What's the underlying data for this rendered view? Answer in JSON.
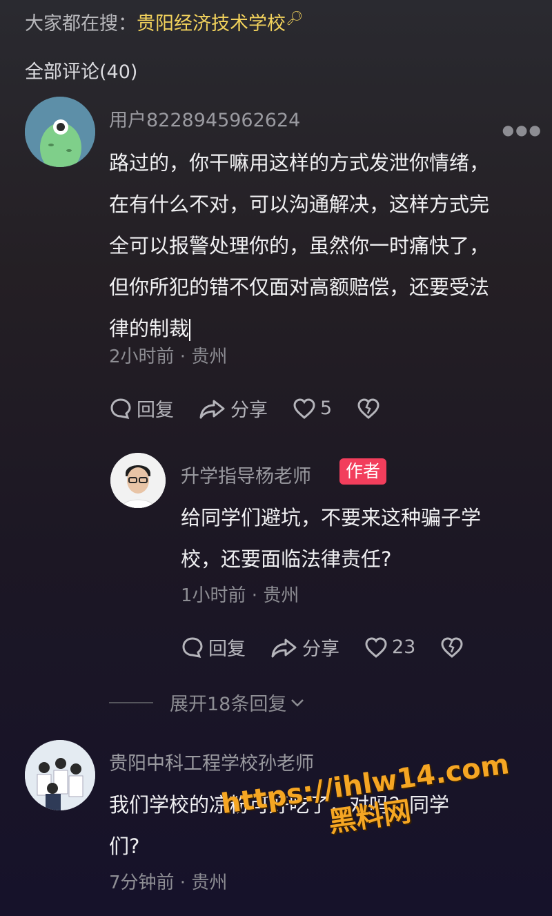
{
  "search_hint": {
    "prefix": "大家都在搜：",
    "keyword": "贵阳经济技术学校"
  },
  "comment_count": "全部评论(40)",
  "comments": [
    {
      "username": "用户8228945962624",
      "lines": [
        "路过的，你干嘛用这样的方式发泄你情绪，",
        "在有什么不对，可以沟通解决，这样方式完",
        "全可以报警处理你的，虽然你一时痛快了，",
        "但你所犯的错不仅面对高额赔偿，还要受法",
        "律的制裁"
      ],
      "meta": "2小时前 · 贵州",
      "reply_label": "回复",
      "share_label": "分享",
      "likes": "5",
      "reply": {
        "username": "升学指导杨老师",
        "badge": "作者",
        "lines": [
          "给同学们避坑，不要来这种骗子学",
          "校，还要面临法律责任?"
        ],
        "meta": "1小时前 · 贵州",
        "reply_label": "回复",
        "share_label": "分享",
        "likes": "23"
      },
      "expand_label": "展开18条回复"
    },
    {
      "username": "贵阳中科工程学校孙老师",
      "lines": [
        "我们学校的凉粉可好吃了，对吗？同学",
        "们?"
      ],
      "meta": "7分钟前 · 贵州"
    }
  ],
  "watermark": {
    "line1": "https://ihlw14.com",
    "line2": "黑料网"
  },
  "colors": {
    "accent": "#f2d25c",
    "badge": "#f23e5c"
  }
}
